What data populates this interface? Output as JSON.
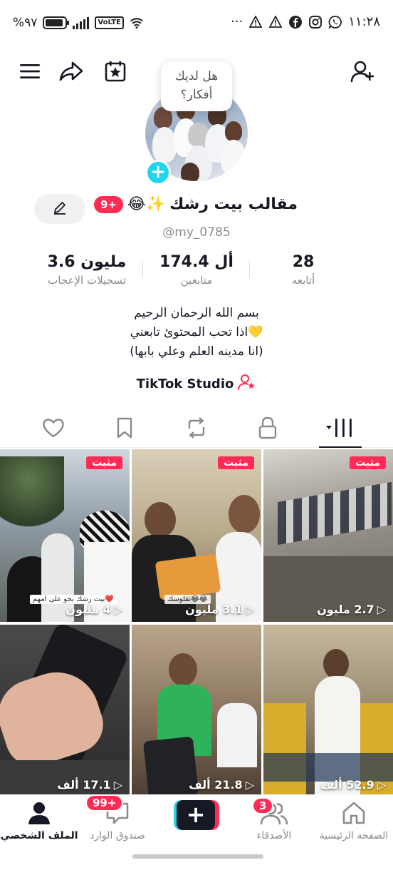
{
  "status_bar": {
    "battery": "%٩٧",
    "network": "VoLTE",
    "time": "١١:٢٨",
    "more": "···"
  },
  "profile": {
    "thought_bubble": "هل لديك\nأفكار؟",
    "name": "مقالب بيت رشك",
    "name_emojis": "✨😂",
    "badge": "+9",
    "handle": "@my_0785"
  },
  "stats": [
    {
      "value": "28",
      "label": "أتابعه"
    },
    {
      "value": "174.4 أل",
      "label": "متابعين"
    },
    {
      "value": "3.6 مليون",
      "label": "تسجيلات الإعجاب"
    }
  ],
  "bio": {
    "line1": "بسم الله الرحمان الرحيم",
    "line2": "اذا تحب المحتوئ تابعني💛",
    "line3": "(انا مدينه العلم وعلي بابها)"
  },
  "studio_link": "TikTok Studio",
  "videos": [
    {
      "views": "2.7 مليون",
      "pinned": "مثبت"
    },
    {
      "views": "3.1 مليون",
      "pinned": "مثبت"
    },
    {
      "views": "4 مليون",
      "pinned": "مثبت",
      "caption": "بيت رشك بجو على امهم❤️"
    },
    {
      "views": "52.9 ألف"
    },
    {
      "views": "21.8 ألف"
    },
    {
      "views": "17.1 ألف"
    }
  ],
  "video_overlays": {
    "cell2_text": "نفلوسك😂😂"
  },
  "bottom_nav": {
    "home": "الصفحة الرئيسية",
    "friends": "الأصدقاء",
    "friends_badge": "3",
    "inbox": "صندوق الوارد",
    "inbox_badge": "99+",
    "profile": "الملف الشخصي",
    "create": "+"
  },
  "colors": {
    "accent_red": "#fe2c55",
    "accent_cyan": "#20d5ec",
    "text": "#161823",
    "muted": "#8a8b91"
  }
}
